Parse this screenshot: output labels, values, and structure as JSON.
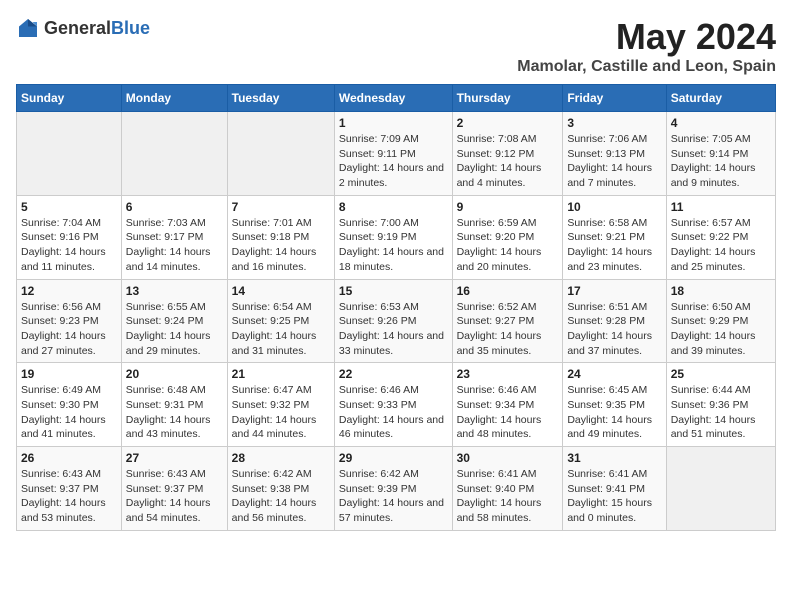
{
  "header": {
    "logo_general": "General",
    "logo_blue": "Blue",
    "title": "May 2024",
    "subtitle": "Mamolar, Castille and Leon, Spain"
  },
  "weekdays": [
    "Sunday",
    "Monday",
    "Tuesday",
    "Wednesday",
    "Thursday",
    "Friday",
    "Saturday"
  ],
  "weeks": [
    [
      {
        "day": "",
        "sunrise": "",
        "sunset": "",
        "daylight": "",
        "empty": true
      },
      {
        "day": "",
        "sunrise": "",
        "sunset": "",
        "daylight": "",
        "empty": true
      },
      {
        "day": "",
        "sunrise": "",
        "sunset": "",
        "daylight": "",
        "empty": true
      },
      {
        "day": "1",
        "sunrise": "Sunrise: 7:09 AM",
        "sunset": "Sunset: 9:11 PM",
        "daylight": "Daylight: 14 hours and 2 minutes."
      },
      {
        "day": "2",
        "sunrise": "Sunrise: 7:08 AM",
        "sunset": "Sunset: 9:12 PM",
        "daylight": "Daylight: 14 hours and 4 minutes."
      },
      {
        "day": "3",
        "sunrise": "Sunrise: 7:06 AM",
        "sunset": "Sunset: 9:13 PM",
        "daylight": "Daylight: 14 hours and 7 minutes."
      },
      {
        "day": "4",
        "sunrise": "Sunrise: 7:05 AM",
        "sunset": "Sunset: 9:14 PM",
        "daylight": "Daylight: 14 hours and 9 minutes."
      }
    ],
    [
      {
        "day": "5",
        "sunrise": "Sunrise: 7:04 AM",
        "sunset": "Sunset: 9:16 PM",
        "daylight": "Daylight: 14 hours and 11 minutes."
      },
      {
        "day": "6",
        "sunrise": "Sunrise: 7:03 AM",
        "sunset": "Sunset: 9:17 PM",
        "daylight": "Daylight: 14 hours and 14 minutes."
      },
      {
        "day": "7",
        "sunrise": "Sunrise: 7:01 AM",
        "sunset": "Sunset: 9:18 PM",
        "daylight": "Daylight: 14 hours and 16 minutes."
      },
      {
        "day": "8",
        "sunrise": "Sunrise: 7:00 AM",
        "sunset": "Sunset: 9:19 PM",
        "daylight": "Daylight: 14 hours and 18 minutes."
      },
      {
        "day": "9",
        "sunrise": "Sunrise: 6:59 AM",
        "sunset": "Sunset: 9:20 PM",
        "daylight": "Daylight: 14 hours and 20 minutes."
      },
      {
        "day": "10",
        "sunrise": "Sunrise: 6:58 AM",
        "sunset": "Sunset: 9:21 PM",
        "daylight": "Daylight: 14 hours and 23 minutes."
      },
      {
        "day": "11",
        "sunrise": "Sunrise: 6:57 AM",
        "sunset": "Sunset: 9:22 PM",
        "daylight": "Daylight: 14 hours and 25 minutes."
      }
    ],
    [
      {
        "day": "12",
        "sunrise": "Sunrise: 6:56 AM",
        "sunset": "Sunset: 9:23 PM",
        "daylight": "Daylight: 14 hours and 27 minutes."
      },
      {
        "day": "13",
        "sunrise": "Sunrise: 6:55 AM",
        "sunset": "Sunset: 9:24 PM",
        "daylight": "Daylight: 14 hours and 29 minutes."
      },
      {
        "day": "14",
        "sunrise": "Sunrise: 6:54 AM",
        "sunset": "Sunset: 9:25 PM",
        "daylight": "Daylight: 14 hours and 31 minutes."
      },
      {
        "day": "15",
        "sunrise": "Sunrise: 6:53 AM",
        "sunset": "Sunset: 9:26 PM",
        "daylight": "Daylight: 14 hours and 33 minutes."
      },
      {
        "day": "16",
        "sunrise": "Sunrise: 6:52 AM",
        "sunset": "Sunset: 9:27 PM",
        "daylight": "Daylight: 14 hours and 35 minutes."
      },
      {
        "day": "17",
        "sunrise": "Sunrise: 6:51 AM",
        "sunset": "Sunset: 9:28 PM",
        "daylight": "Daylight: 14 hours and 37 minutes."
      },
      {
        "day": "18",
        "sunrise": "Sunrise: 6:50 AM",
        "sunset": "Sunset: 9:29 PM",
        "daylight": "Daylight: 14 hours and 39 minutes."
      }
    ],
    [
      {
        "day": "19",
        "sunrise": "Sunrise: 6:49 AM",
        "sunset": "Sunset: 9:30 PM",
        "daylight": "Daylight: 14 hours and 41 minutes."
      },
      {
        "day": "20",
        "sunrise": "Sunrise: 6:48 AM",
        "sunset": "Sunset: 9:31 PM",
        "daylight": "Daylight: 14 hours and 43 minutes."
      },
      {
        "day": "21",
        "sunrise": "Sunrise: 6:47 AM",
        "sunset": "Sunset: 9:32 PM",
        "daylight": "Daylight: 14 hours and 44 minutes."
      },
      {
        "day": "22",
        "sunrise": "Sunrise: 6:46 AM",
        "sunset": "Sunset: 9:33 PM",
        "daylight": "Daylight: 14 hours and 46 minutes."
      },
      {
        "day": "23",
        "sunrise": "Sunrise: 6:46 AM",
        "sunset": "Sunset: 9:34 PM",
        "daylight": "Daylight: 14 hours and 48 minutes."
      },
      {
        "day": "24",
        "sunrise": "Sunrise: 6:45 AM",
        "sunset": "Sunset: 9:35 PM",
        "daylight": "Daylight: 14 hours and 49 minutes."
      },
      {
        "day": "25",
        "sunrise": "Sunrise: 6:44 AM",
        "sunset": "Sunset: 9:36 PM",
        "daylight": "Daylight: 14 hours and 51 minutes."
      }
    ],
    [
      {
        "day": "26",
        "sunrise": "Sunrise: 6:43 AM",
        "sunset": "Sunset: 9:37 PM",
        "daylight": "Daylight: 14 hours and 53 minutes."
      },
      {
        "day": "27",
        "sunrise": "Sunrise: 6:43 AM",
        "sunset": "Sunset: 9:37 PM",
        "daylight": "Daylight: 14 hours and 54 minutes."
      },
      {
        "day": "28",
        "sunrise": "Sunrise: 6:42 AM",
        "sunset": "Sunset: 9:38 PM",
        "daylight": "Daylight: 14 hours and 56 minutes."
      },
      {
        "day": "29",
        "sunrise": "Sunrise: 6:42 AM",
        "sunset": "Sunset: 9:39 PM",
        "daylight": "Daylight: 14 hours and 57 minutes."
      },
      {
        "day": "30",
        "sunrise": "Sunrise: 6:41 AM",
        "sunset": "Sunset: 9:40 PM",
        "daylight": "Daylight: 14 hours and 58 minutes."
      },
      {
        "day": "31",
        "sunrise": "Sunrise: 6:41 AM",
        "sunset": "Sunset: 9:41 PM",
        "daylight": "Daylight: 15 hours and 0 minutes."
      },
      {
        "day": "",
        "sunrise": "",
        "sunset": "",
        "daylight": "",
        "empty": true
      }
    ]
  ]
}
